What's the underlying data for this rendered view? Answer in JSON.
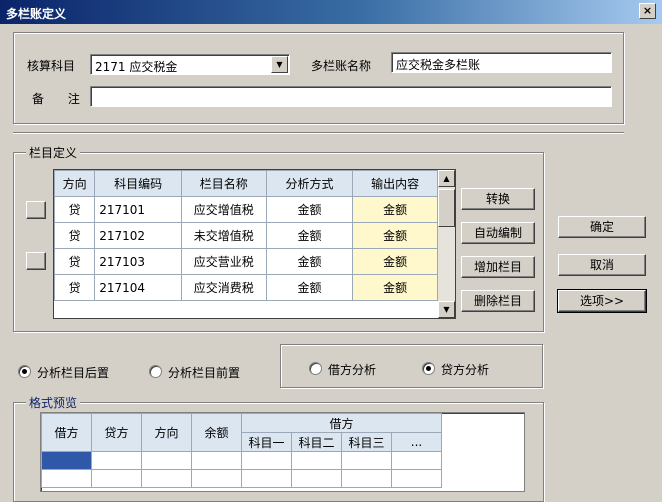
{
  "window": {
    "title": "多栏账定义",
    "close_label": "×"
  },
  "header": {
    "subject_label": "核算科目",
    "subject_value": "2171 应交税金",
    "name_label": "多栏账名称",
    "name_value": "应交税金多栏账",
    "remark_label": "备 注",
    "remark_value": ""
  },
  "columns_group": {
    "legend": "栏目定义",
    "table": {
      "headers": [
        "方向",
        "科目编码",
        "栏目名称",
        "分析方式",
        "输出内容"
      ],
      "rows": [
        [
          "贷",
          "217101",
          "应交增值税",
          "金额",
          "金额"
        ],
        [
          "贷",
          "217102",
          "未交增值税",
          "金额",
          "金额"
        ],
        [
          "贷",
          "217103",
          "应交营业税",
          "金额",
          "金额"
        ],
        [
          "贷",
          "217104",
          "应交消费税",
          "金额",
          "金额"
        ]
      ]
    },
    "buttons": {
      "convert": "转换",
      "auto": "自动编制",
      "add": "增加栏目",
      "delete": "删除栏目"
    }
  },
  "side_buttons": {
    "ok": "确定",
    "cancel": "取消",
    "options": "选项>>"
  },
  "position_options": {
    "after": "分析栏目后置",
    "before": "分析栏目前置",
    "selected": "after"
  },
  "analysis_options": {
    "debit": "借方分析",
    "credit": "贷方分析",
    "selected": "credit"
  },
  "preview": {
    "legend": "格式预览",
    "headers": [
      "借方",
      "贷方",
      "方向",
      "余额"
    ],
    "group_header": "借方",
    "sub_headers": [
      "科目一",
      "科目二",
      "科目三",
      "..."
    ]
  }
}
